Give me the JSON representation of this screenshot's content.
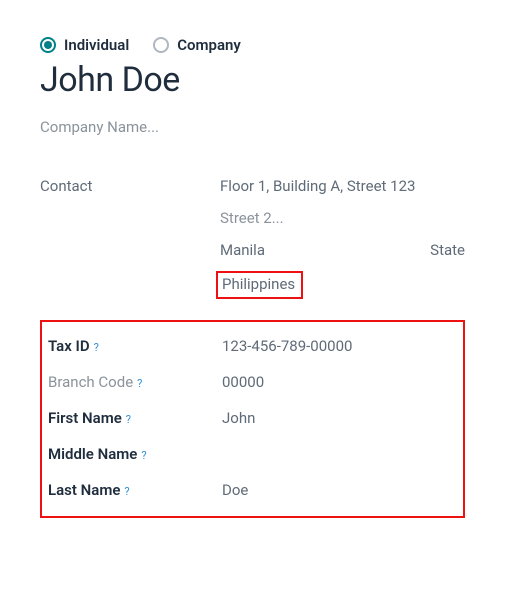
{
  "type_radio": {
    "individual": "Individual",
    "company": "Company"
  },
  "name": "John Doe",
  "company_name_placeholder": "Company Name...",
  "contact_label": "Contact",
  "address": {
    "street1": "Floor 1, Building A, Street 123",
    "street2_placeholder": "Street 2...",
    "city": "Manila",
    "state_placeholder": "State",
    "country": "Philippines"
  },
  "fields": {
    "tax_id": {
      "label": "Tax ID",
      "value": "123-456-789-00000"
    },
    "branch_code": {
      "label": "Branch Code",
      "value": "00000"
    },
    "first_name": {
      "label": "First Name",
      "value": "John"
    },
    "middle_name": {
      "label": "Middle Name",
      "value": ""
    },
    "last_name": {
      "label": "Last Name",
      "value": "Doe"
    }
  },
  "help_char": "?"
}
